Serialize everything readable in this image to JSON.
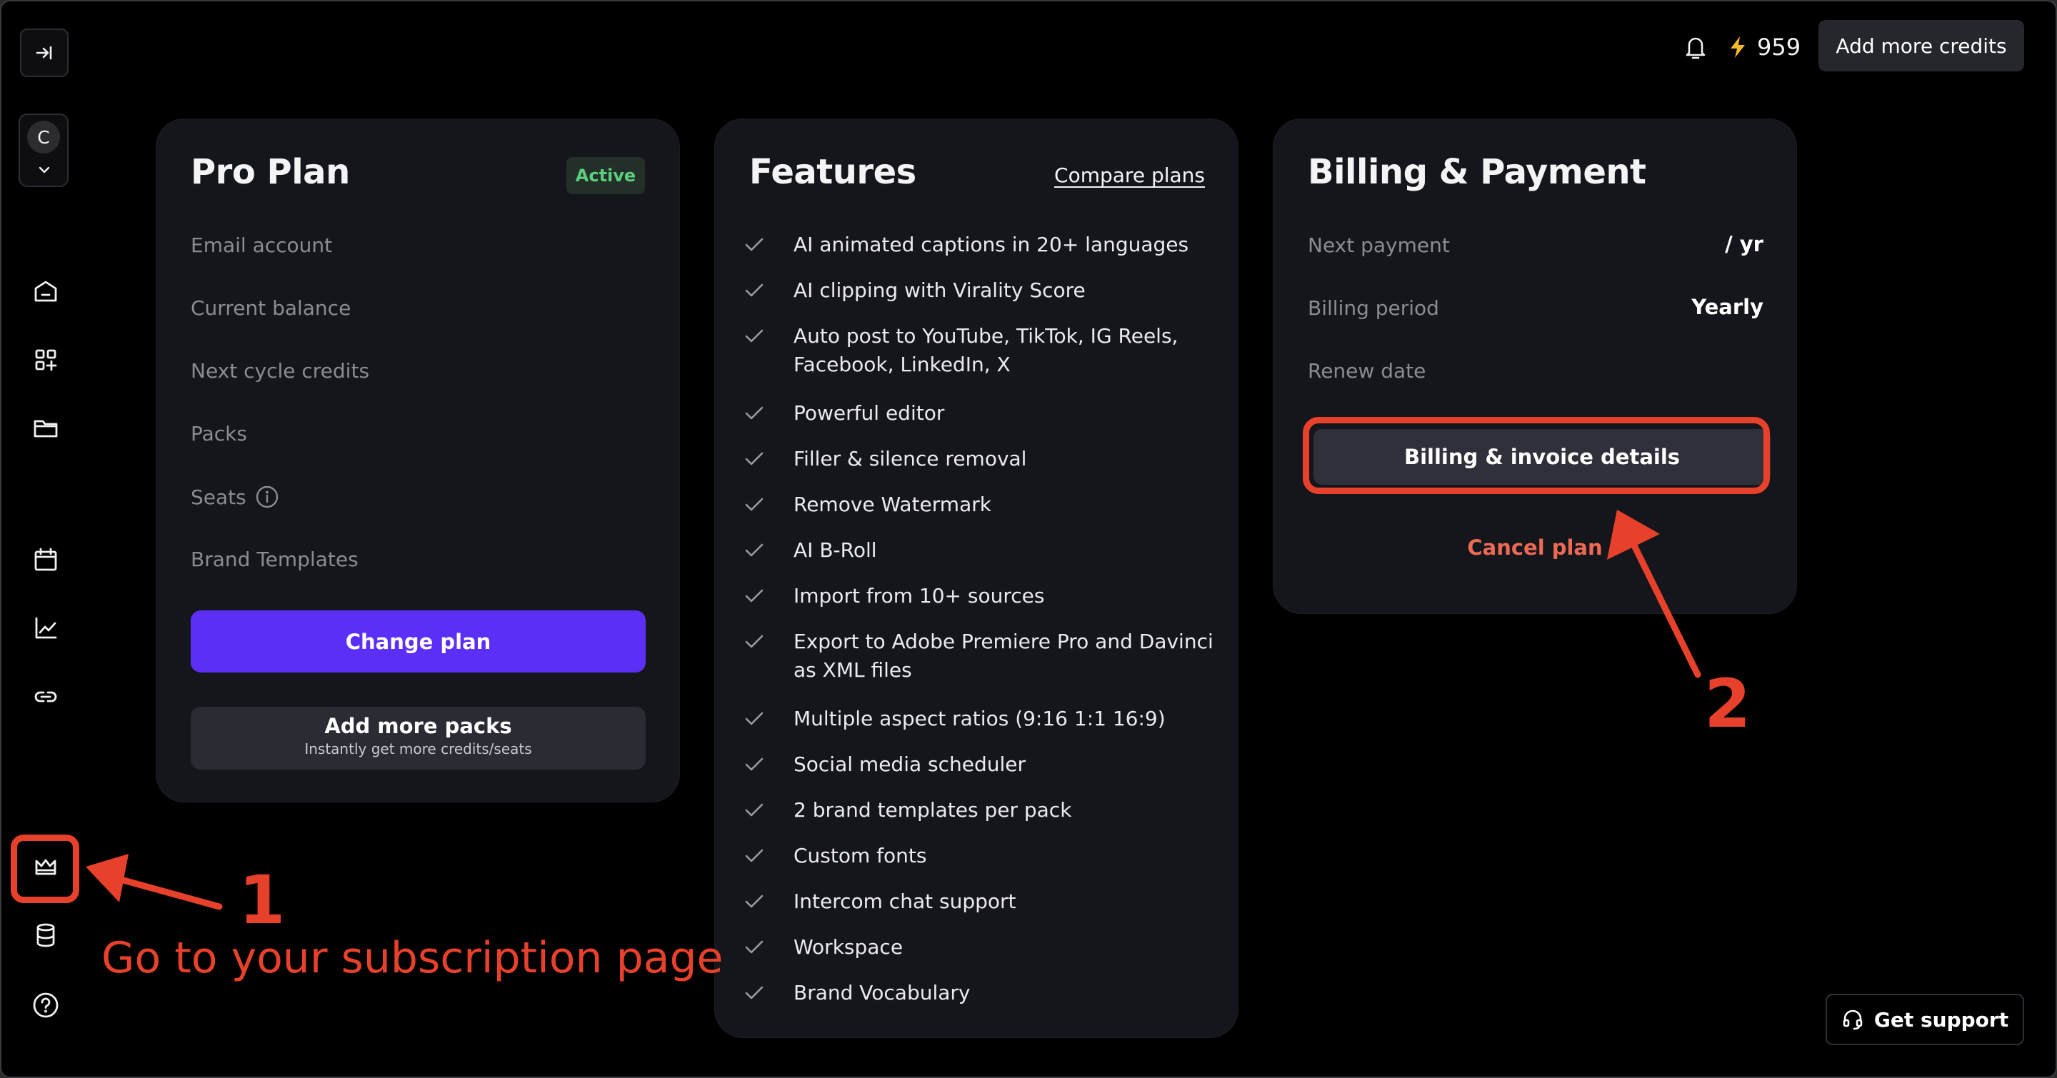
{
  "topbar": {
    "credits_value": "959",
    "add_credits_label": "Add more credits"
  },
  "sidebar": {
    "account_initial": "C",
    "items": [
      {
        "name": "home-icon"
      },
      {
        "name": "apps-icon"
      },
      {
        "name": "folder-icon"
      },
      {
        "name": "calendar-icon"
      },
      {
        "name": "analytics-icon"
      },
      {
        "name": "link-icon"
      },
      {
        "name": "crown-icon"
      },
      {
        "name": "database-icon"
      },
      {
        "name": "help-icon"
      }
    ]
  },
  "plan": {
    "title": "Pro Plan",
    "badge": "Active",
    "rows": [
      "Email account",
      "Current balance",
      "Next cycle credits",
      "Packs",
      "Seats",
      "Brand Templates"
    ],
    "change_plan_label": "Change plan",
    "add_packs_label": "Add more packs",
    "add_packs_sub": "Instantly get more credits/seats"
  },
  "features": {
    "title": "Features",
    "compare_link": "Compare plans",
    "items": [
      "AI animated captions in 20+ languages",
      "AI clipping with Virality Score",
      "Auto post to YouTube, TikTok, IG Reels, Facebook, LinkedIn, X",
      "Powerful editor",
      "Filler & silence removal",
      "Remove Watermark",
      "AI B-Roll",
      "Import from 10+ sources",
      "Export to Adobe Premiere Pro and Davinci as XML files",
      "Multiple aspect ratios (9:16 1:1 16:9)",
      "Social media scheduler",
      "2 brand templates per pack",
      "Custom fonts",
      "Intercom chat support",
      "Workspace",
      "Brand Vocabulary"
    ]
  },
  "billing": {
    "title": "Billing & Payment",
    "next_payment_label": "Next payment",
    "next_payment_value": "/ yr",
    "period_label": "Billing period",
    "period_value": "Yearly",
    "renew_label": "Renew date",
    "details_button": "Billing & invoice details",
    "cancel_label": "Cancel plan"
  },
  "support_label": "Get support",
  "annotations": {
    "step1_number": "1",
    "step1_text": "Go to your subscription page",
    "step2_number": "2",
    "color": "#e8412b"
  }
}
